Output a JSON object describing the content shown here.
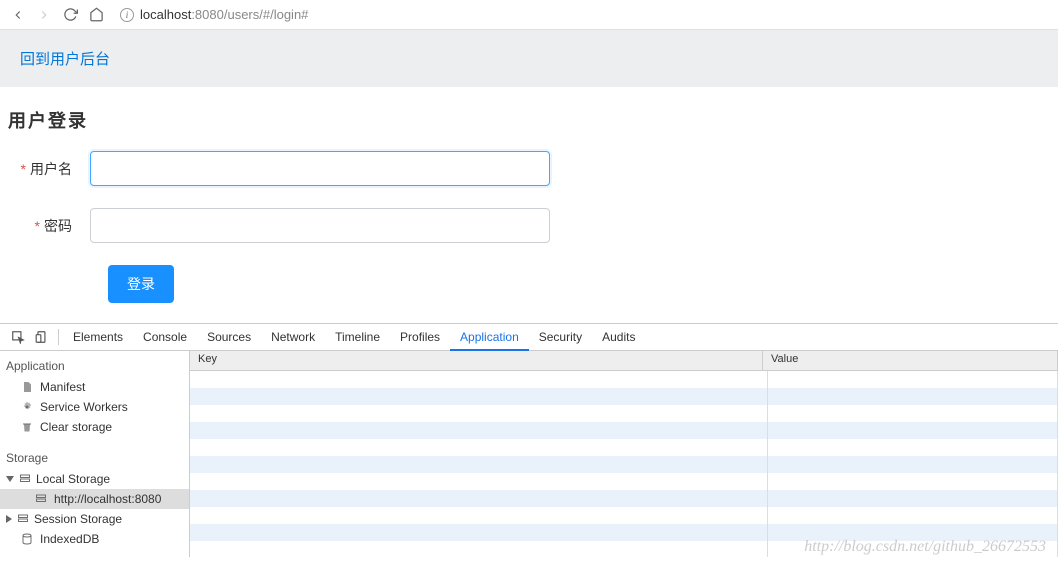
{
  "browser": {
    "url_host": "localhost",
    "url_port": ":8080",
    "url_path": "/users/#/login#"
  },
  "page": {
    "banner_link": "回到用户后台",
    "title": "用户登录",
    "username_label": "用户名",
    "password_label": "密码",
    "login_button": "登录"
  },
  "devtools": {
    "tabs": {
      "elements": "Elements",
      "console": "Console",
      "sources": "Sources",
      "network": "Network",
      "timeline": "Timeline",
      "profiles": "Profiles",
      "application": "Application",
      "security": "Security",
      "audits": "Audits"
    },
    "active_tab": "Application",
    "sidebar": {
      "application_heading": "Application",
      "manifest": "Manifest",
      "service_workers": "Service Workers",
      "clear_storage": "Clear storage",
      "storage_heading": "Storage",
      "local_storage": "Local Storage",
      "local_storage_item": "http://localhost:8080",
      "session_storage": "Session Storage",
      "indexed_db": "IndexedDB"
    },
    "table": {
      "key_header": "Key",
      "value_header": "Value"
    }
  },
  "watermark": "http://blog.csdn.net/github_26672553"
}
